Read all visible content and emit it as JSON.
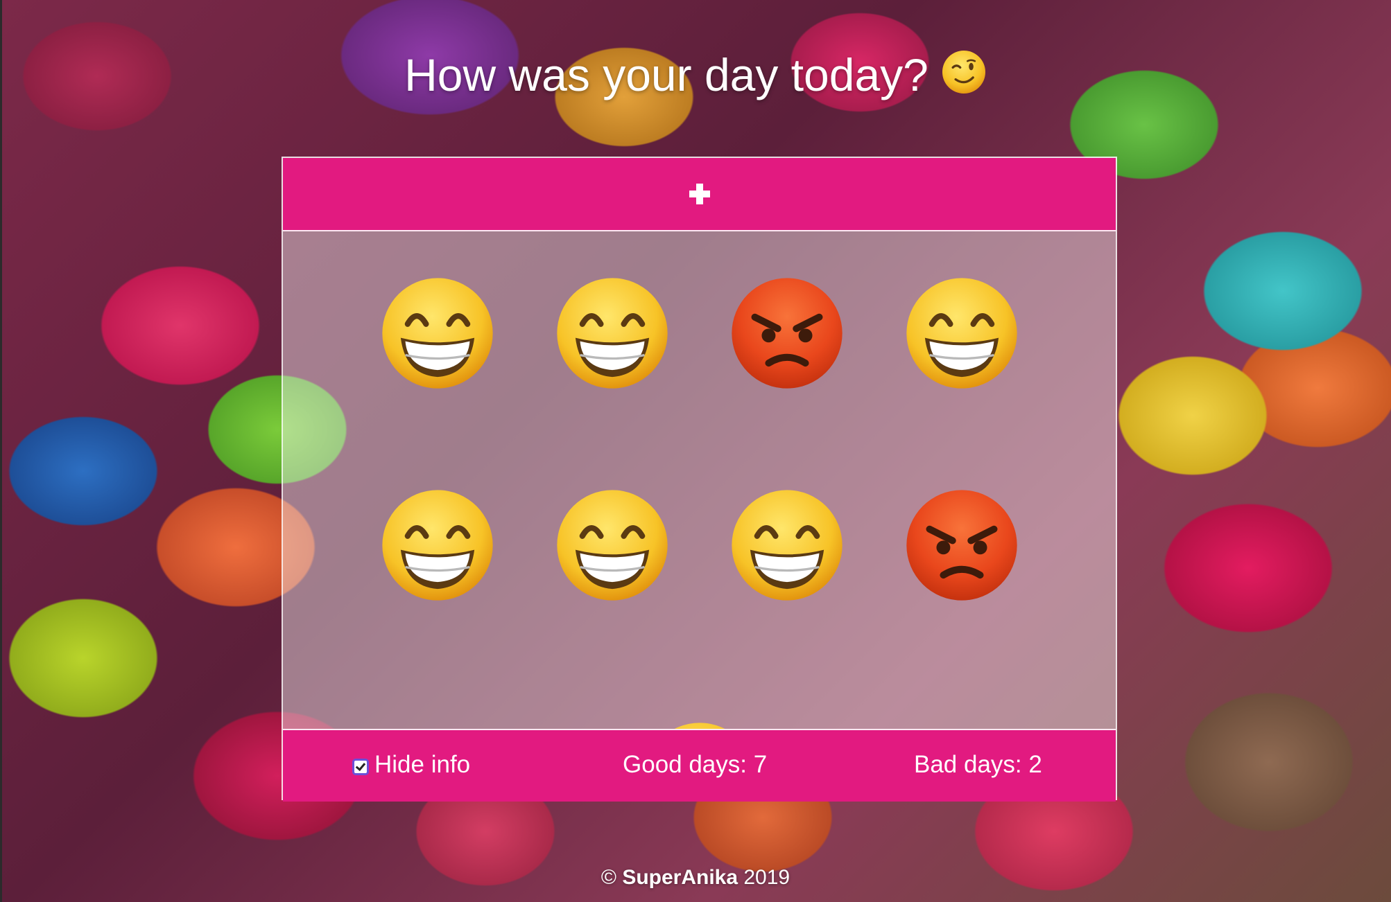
{
  "header": {
    "title": "How was your day today?",
    "title_icon": "winking-face-emoji"
  },
  "panel": {
    "add_icon": "plus-icon",
    "days": [
      {
        "mood": "good",
        "icon": "grinning-face-emoji"
      },
      {
        "mood": "good",
        "icon": "grinning-face-emoji"
      },
      {
        "mood": "bad",
        "icon": "angry-face-emoji"
      },
      {
        "mood": "good",
        "icon": "grinning-face-emoji"
      },
      {
        "mood": "good",
        "icon": "grinning-face-emoji"
      },
      {
        "mood": "good",
        "icon": "grinning-face-emoji"
      },
      {
        "mood": "good",
        "icon": "grinning-face-emoji"
      },
      {
        "mood": "bad",
        "icon": "angry-face-emoji"
      },
      {
        "mood": "good",
        "icon": "grinning-face-emoji"
      }
    ],
    "footer": {
      "hide_info_label": "Hide info",
      "hide_info_checked": true,
      "good_days_label": "Good days: 7",
      "bad_days_label": "Bad days: 2"
    }
  },
  "footer": {
    "copyright_symbol": "©",
    "brand": "SuperAnika",
    "year": "2019"
  },
  "colors": {
    "accent": "#e21a80",
    "checkbox_border": "#6b4fd8"
  }
}
